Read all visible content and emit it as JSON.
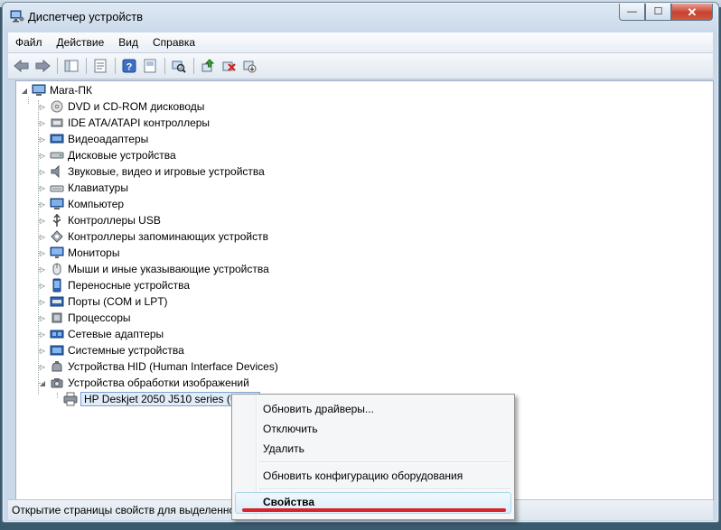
{
  "window": {
    "title": "Диспетчер устройств",
    "buttons": {
      "minimize": "—",
      "maximize": "☐",
      "close": "✕"
    }
  },
  "menu": [
    "Файл",
    "Действие",
    "Вид",
    "Справка"
  ],
  "toolbar": {
    "icons": [
      "back-arrow-icon",
      "forward-arrow-icon",
      "show-hide-tree-icon",
      "properties-icon",
      "help-icon",
      "view-icon",
      "scan-hardware-icon",
      "update-driver-icon",
      "uninstall-icon",
      "disable-icon"
    ]
  },
  "tree": {
    "root": "Mara-ПК",
    "categories": [
      {
        "label": "DVD и CD-ROM дисководы",
        "icon": "dvd-icon"
      },
      {
        "label": "IDE ATA/ATAPI контроллеры",
        "icon": "ide-controller-icon"
      },
      {
        "label": "Видеоадаптеры",
        "icon": "display-adapter-icon"
      },
      {
        "label": "Дисковые устройства",
        "icon": "disk-drive-icon"
      },
      {
        "label": "Звуковые, видео и игровые устройства",
        "icon": "speaker-icon"
      },
      {
        "label": "Клавиатуры",
        "icon": "keyboard-icon"
      },
      {
        "label": "Компьютер",
        "icon": "computer-icon"
      },
      {
        "label": "Контроллеры USB",
        "icon": "usb-icon"
      },
      {
        "label": "Контроллеры запоминающих устройств",
        "icon": "storage-controller-icon"
      },
      {
        "label": "Мониторы",
        "icon": "monitor-icon"
      },
      {
        "label": "Мыши и иные указывающие устройства",
        "icon": "mouse-icon"
      },
      {
        "label": "Переносные устройства",
        "icon": "portable-device-icon"
      },
      {
        "label": "Порты (COM и LPT)",
        "icon": "port-icon"
      },
      {
        "label": "Процессоры",
        "icon": "processor-icon"
      },
      {
        "label": "Сетевые адаптеры",
        "icon": "network-adapter-icon"
      },
      {
        "label": "Системные устройства",
        "icon": "system-device-icon"
      },
      {
        "label": "Устройства HID (Human Interface Devices)",
        "icon": "hid-icon"
      },
      {
        "label": "Устройства обработки изображений",
        "icon": "imaging-device-icon"
      }
    ],
    "selected_child": "HP Deskjet 2050 J510 series (USB)"
  },
  "status": "Открытие страницы свойств для выделенного",
  "context_menu": {
    "items": [
      "Обновить драйверы...",
      "Отключить",
      "Удалить",
      "Обновить конфигурацию оборудования",
      "Свойства"
    ]
  },
  "colors": {
    "accent": "#d8232a",
    "selection": "#e1ecf8"
  }
}
